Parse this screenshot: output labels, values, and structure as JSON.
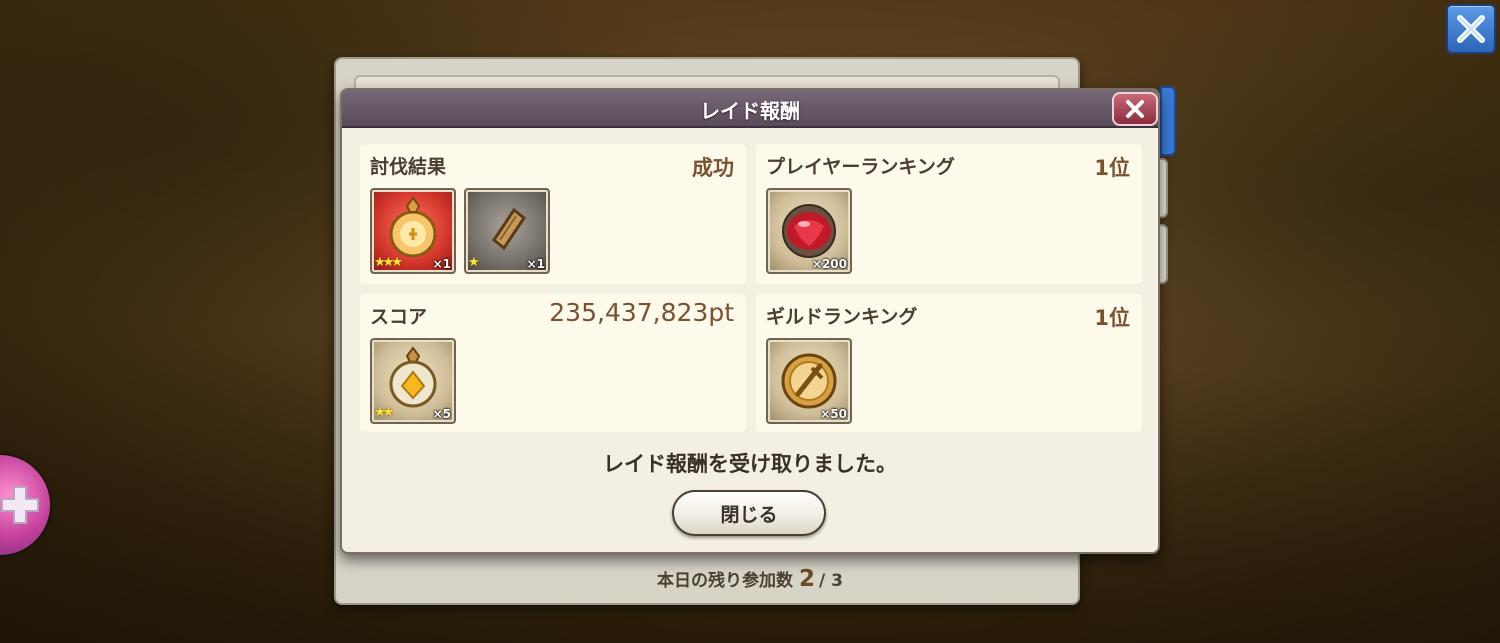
{
  "dialog": {
    "title": "レイド報酬",
    "message": "レイド報酬を受け取りました。",
    "close_button_label": "閉じる"
  },
  "cards": {
    "result": {
      "label": "討伐結果",
      "value": "成功",
      "items": [
        {
          "icon": "lamp-orb-icon",
          "stars": "★★★",
          "count": "×1",
          "frame": "red"
        },
        {
          "icon": "scroll-icon",
          "stars": "★",
          "count": "×1",
          "frame": "gray"
        }
      ]
    },
    "player_ranking": {
      "label": "プレイヤーランキング",
      "value": "1位",
      "items": [
        {
          "icon": "ruby-gem-icon",
          "count": "×200",
          "frame": "tan"
        }
      ]
    },
    "score": {
      "label": "スコア",
      "value": "235,437,823pt",
      "items": [
        {
          "icon": "gold-orb-icon",
          "stars": "★★",
          "count": "×5",
          "frame": "tan"
        }
      ]
    },
    "guild_ranking": {
      "label": "ギルドランキング",
      "value": "1位",
      "items": [
        {
          "icon": "sword-medal-icon",
          "count": "×50",
          "frame": "tan"
        }
      ]
    }
  },
  "footer": {
    "remaining_label": "本日の残り参加数",
    "remaining_count": "2",
    "remaining_total": "/ 3"
  },
  "colors": {
    "header": "#5a4c5a",
    "close_red": "#8a2c3e",
    "screen_close_blue": "#2c64b8",
    "value_brown": "#7a5230"
  }
}
